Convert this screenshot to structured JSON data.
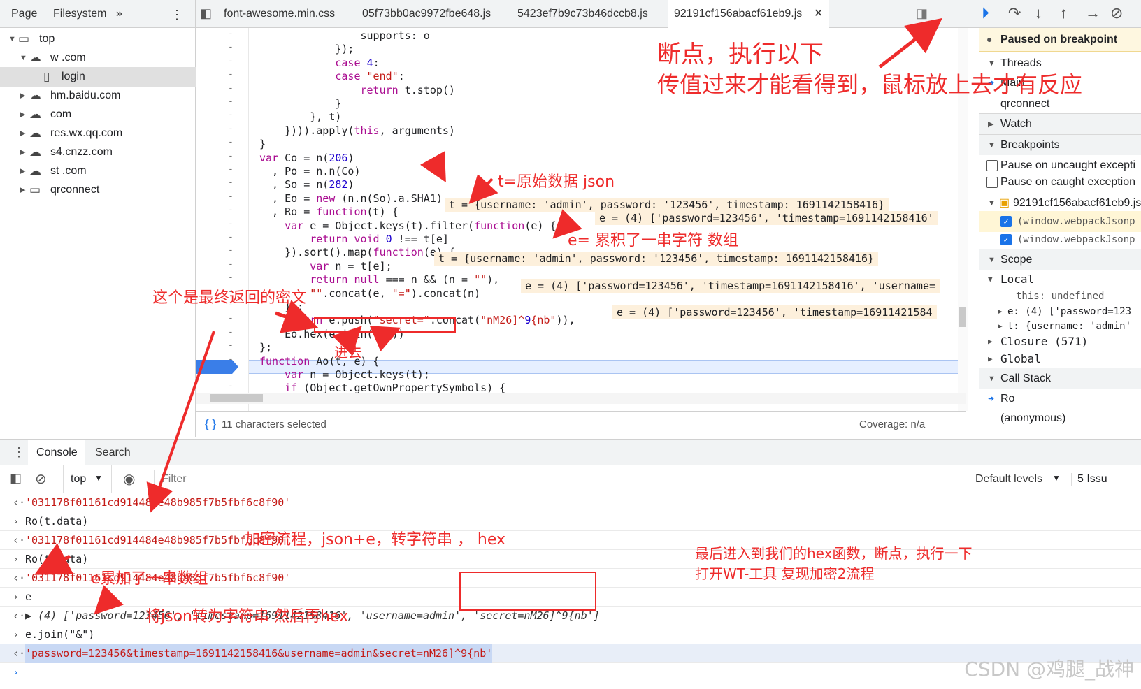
{
  "nav_tabs": {
    "page": "Page",
    "filesystem": "Filesystem",
    "more": "»"
  },
  "file_tabs": [
    "font-awesome.min.css",
    "05f73bb0ac9972fbe648.js",
    "5423ef7b9c73b46dccb8.js",
    "92191cf156abacf61eb9.js"
  ],
  "file_tree": [
    {
      "label": "top",
      "level": 0,
      "icon": "frame"
    },
    {
      "label": "w                .com",
      "level": 1,
      "icon": "cloud"
    },
    {
      "label": "login",
      "level": 2,
      "icon": "file",
      "selected": true
    },
    {
      "label": "hm.baidu.com",
      "level": 1,
      "icon": "cloud"
    },
    {
      "label": "                 com",
      "level": 1,
      "icon": "cloud"
    },
    {
      "label": "res.wx.qq.com",
      "level": 1,
      "icon": "cloud"
    },
    {
      "label": "s4.cnzz.com",
      "level": 1,
      "icon": "cloud"
    },
    {
      "label": "st                    .com",
      "level": 1,
      "icon": "cloud"
    },
    {
      "label": "qrconnect",
      "level": 1,
      "icon": "frame"
    }
  ],
  "code_lines": [
    "                supports: o",
    "            });",
    "            case 4:",
    "            case \"end\":",
    "                return t.stop()",
    "            }",
    "        }, t)",
    "    }))).apply(this, arguments)",
    "}",
    "var Co = n(206)",
    "  , Po = n.n(Co)",
    "  , So = n(282)",
    "  , Eo = new (n.n(So).a.SHA1)",
    "  , Ro = function(t) {",
    "    var e = Object.keys(t).filter(function(e) {",
    "        return void 0 !== t[e]",
    "    }).sort().map(function(e) {",
    "        var n = t[e];",
    "        return null === n && (n = \"\"),",
    "        \"\".concat(e, \"=\").concat(n)",
    "    });",
    "    return e.push(\"secret=\".concat(\"nM26]^9{nb\")),",
    "    Eo.hex(e.join(\"&\"))",
    "};",
    "function Ao(t, e) {",
    "    var n = Object.keys(t);",
    "    if (Object.getOwnPropertySymbols) {"
  ],
  "inline_values": [
    "t = {username: 'admin', password: '123456', timestamp: 1691142158416}",
    "e = (4) ['password=123456', 'timestamp=1691142158416'",
    "t = {username: 'admin', password: '123456', timestamp: 1691142158416}",
    "e = (4) ['password=123456', 'timestamp=1691142158416', 'username=",
    "e = (4) ['password=123456', 'timestamp=16911421584"
  ],
  "status": {
    "selected": "11 characters selected",
    "coverage": "Coverage: n/a"
  },
  "sidebar": {
    "paused": "Paused on breakpoint",
    "threads": "Threads",
    "main": "Main",
    "qrconnect": "qrconnect",
    "watch": "Watch",
    "breakpoints": "Breakpoints",
    "pause_uncaught": "Pause on uncaught excepti",
    "pause_caught": "Pause on caught exception",
    "bp_file": "92191cf156abacf61eb9.js",
    "bp1": "(window.webpackJsonp",
    "bp2": "(window.webpackJsonp",
    "scope": "Scope",
    "local": "Local",
    "this_val": "this: undefined",
    "e_val": "e: (4) ['password=123",
    "t_val": "t: {username: 'admin'",
    "closure": "Closure (571)",
    "global": "Global",
    "call_stack": "Call Stack",
    "frame1": "Ro",
    "frame2": "(anonymous)"
  },
  "drawer": {
    "console": "Console",
    "search": "Search"
  },
  "console_toolbar": {
    "context": "top",
    "filter_placeholder": "Filter",
    "levels": "Default levels",
    "issues": "5 Issu"
  },
  "console_lines": [
    {
      "type": "out",
      "text": "'031178f01161cd914484e48b985f7b5fbf6c8f90'"
    },
    {
      "type": "in",
      "text": "Ro(t.data)"
    },
    {
      "type": "out",
      "text": "'031178f01161cd914484e48b985f7b5fbf6c8f90'"
    },
    {
      "type": "in",
      "text": "Ro(t.data)"
    },
    {
      "type": "out",
      "text": "'031178f01161cd914484e48b985f7b5fbf6c8f90'"
    },
    {
      "type": "in",
      "text": "e"
    },
    {
      "type": "out",
      "text": "▶ (4) ['password=123456', 'timestamp=1691142158416', 'username=admin', 'secret=nM26]^9{nb']"
    },
    {
      "type": "in",
      "text": "e.join(\"&\")"
    },
    {
      "type": "out",
      "text": "'password=123456&timestamp=1691142158416&username=admin&secret=nM26]^9{nb'"
    }
  ],
  "annotations": {
    "breakpoint_title": "断点，执行以下",
    "breakpoint_sub": "传值过来才能看得到，鼠标放上去才有反应",
    "t_note": "t=原始数据 json",
    "e_note": "e= 累积了一串字符 数组",
    "secret_note": "这个是最终返回的密文",
    "step_in": "进去",
    "flow_note": "加密流程，json+e，转字符串 ， hex",
    "final_note1": "最后进入到我们的hex函数，断点，执行一下",
    "final_note2": "打开WT-工具  复现加密2流程",
    "e_array_note": "e累加了一串数组",
    "join_note": "将json转为字符串   然后再hex"
  },
  "watermark": "CSDN @鸡腿_战神"
}
